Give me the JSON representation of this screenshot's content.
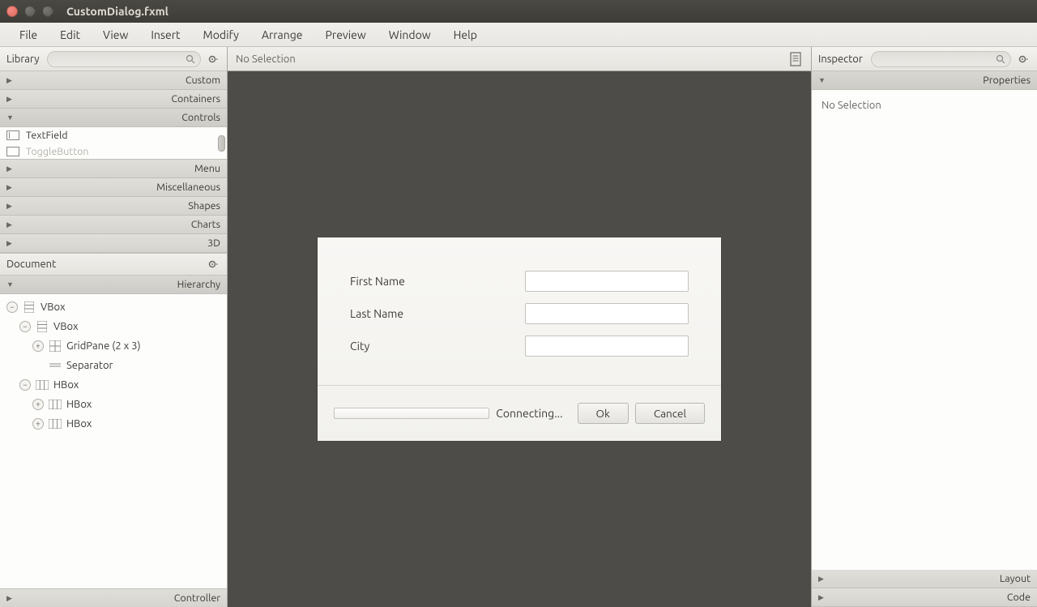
{
  "window": {
    "title": "CustomDialog.fxml"
  },
  "menu": [
    "File",
    "Edit",
    "View",
    "Insert",
    "Modify",
    "Arrange",
    "Preview",
    "Window",
    "Help"
  ],
  "library": {
    "title": "Library",
    "sections": {
      "custom": "Custom",
      "containers": "Containers",
      "controls": "Controls",
      "menu": "Menu",
      "misc": "Miscellaneous",
      "shapes": "Shapes",
      "charts": "Charts",
      "threeD": "3D"
    },
    "controls_list": [
      "TextField",
      "ToggleButton"
    ]
  },
  "document": {
    "title": "Document",
    "hierarchy_label": "Hierarchy",
    "controller_label": "Controller",
    "tree": {
      "n0": "VBox",
      "n1": "VBox",
      "n2": "GridPane (2 x 3)",
      "n3": "Separator",
      "n4": "HBox",
      "n5": "HBox",
      "n6": "HBox"
    }
  },
  "center": {
    "no_selection": "No Selection"
  },
  "dialog": {
    "first_name": "First Name",
    "last_name": "Last Name",
    "city": "City",
    "connecting": "Connecting...",
    "ok": "Ok",
    "cancel": "Cancel"
  },
  "inspector": {
    "title": "Inspector",
    "properties": "Properties",
    "layout": "Layout",
    "code": "Code",
    "no_selection": "No Selection"
  }
}
